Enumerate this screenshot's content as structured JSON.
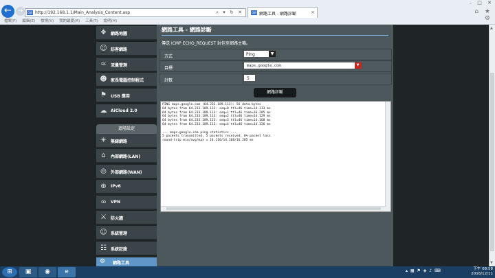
{
  "browser": {
    "address": "http://192.168.1.1/Main_Analysis_Content.asp",
    "address_controls": "⌕ ▾ ↻ ✕",
    "tab_label": "網路工具 - 網路診斷",
    "favicon_text": "GW",
    "window_controls": "– □ ✕",
    "toolbar_icons": "⌂ ★ ⚙",
    "menu": [
      "檔案(F)",
      "編輯(E)",
      "檢視(V)",
      "我的最愛(A)",
      "工具(T)",
      "說明(H)"
    ]
  },
  "sidebar": {
    "top_items": [
      {
        "icon": "❖",
        "label": "網路地圖"
      },
      {
        "icon": "☺",
        "label": "訪客網路"
      },
      {
        "icon": "≈",
        "label": "流量管理"
      },
      {
        "icon": "☻",
        "label": "家長電腦控制程式"
      },
      {
        "icon": "⚑",
        "label": "USB 應用"
      },
      {
        "icon": "☁",
        "label": "AiCloud 2.0"
      }
    ],
    "advanced_header": "進階設定",
    "advanced_items": [
      {
        "icon": "☀",
        "label": "無線網路"
      },
      {
        "icon": "⌂",
        "label": "內部網路(LAN)"
      },
      {
        "icon": "◎",
        "label": "外部網路(WAN)"
      },
      {
        "icon": "⊕",
        "label": "IPv6"
      },
      {
        "icon": "∞",
        "label": "VPN"
      },
      {
        "icon": "⚔",
        "label": "防火牆"
      },
      {
        "icon": "☺",
        "label": "系統管理"
      },
      {
        "icon": "☷",
        "label": "系統記錄"
      }
    ],
    "active_item": {
      "icon": "⚙",
      "label": "網路工具"
    }
  },
  "content": {
    "title": "網路工具 - 網路診斷",
    "description": "傳送 ICMP ECHO_REQUEST 封包至網路主機。",
    "rows": [
      {
        "label": "方式"
      },
      {
        "label": "目標"
      },
      {
        "label": "計數"
      }
    ],
    "method_value": "Ping",
    "target_value": "maps.google.com",
    "count_value": "5",
    "diagnose_button": "網路診斷",
    "output": "PING maps.google.com (64.233.189.113): 56 data bytes\n64 bytes from 64.233.189.113: seq=0 ttl=46 time=14.113 ms\n64 bytes from 64.233.189.113: seq=1 ttl=46 time=16.285 ms\n64 bytes from 64.233.189.113: seq=2 ttl=46 time=14.129 ms\n64 bytes from 64.233.189.113: seq=3 ttl=46 time=14.168 ms\n64 bytes from 64.233.189.113: seq=4 ttl=46 time=14.126 ms\n\n--- maps.google.com ping statistics ---\n5 packets transmitted, 5 packets received, 0% packet loss\nround-trip min/avg/max = 14.110/14.168/16.285 ms"
  },
  "taskbar": {
    "start_icon": "⊞",
    "apps": [
      "▣",
      "◉",
      "e"
    ],
    "tray": "▴ ▦ ⚑ ◈ ♪ ⌨",
    "time": "下午 08:58",
    "date": "2016/12/11"
  }
}
